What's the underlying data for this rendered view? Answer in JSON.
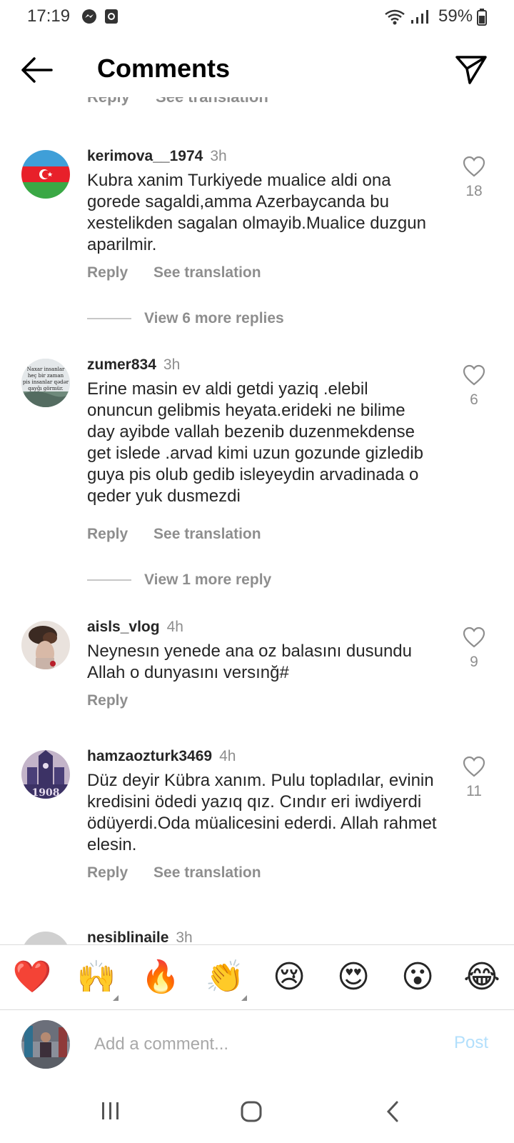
{
  "status_bar": {
    "time": "17:19",
    "battery": "59%"
  },
  "header": {
    "title": "Comments"
  },
  "cut_off_actions": {
    "reply": "Reply",
    "see_translation": "See translation"
  },
  "comments": [
    {
      "username": "kerimova__1974",
      "time": "3h",
      "text": "Kubra xanim Turkiyede mualice aldi ona gorede sagaldi,amma Azerbaycanda  bu xestelikden sagalan olmayib.Mualice duzgun  aparilmir.",
      "likes": "18",
      "reply": "Reply",
      "see_translation": "See translation",
      "view_more": "View 6 more replies"
    },
    {
      "username": "zumer834",
      "time": "3h",
      "text": "Erine masin ev aldi getdi yaziq .elebil onuncun gelibmis heyata.erideki ne bilime day ayibde vallah bezenib duzenmekdense get islede .arvad kimi uzun gozunde gizledib guya pis olub gedib isleyeydin arvadinada o qeder yuk dusmezdi",
      "likes": "6",
      "reply": "Reply",
      "see_translation": "See translation",
      "view_more": "View 1 more reply",
      "avatar_text": [
        "Naxar insanlar",
        "heç bir zaman",
        "pis insanlar qədər",
        "qayğı görmür."
      ]
    },
    {
      "username": "aisls_vlog",
      "time": "4h",
      "text": "Neynesın yenede ana oz balasını dusundu Allah o dunyasını versınğ#",
      "likes": "9",
      "reply": "Reply"
    },
    {
      "username": "hamzaozturk3469",
      "time": "4h",
      "text": "Düz deyir Kübra xanım. Pulu topladılar, evinin kredisini ödedi yazıq qız. Cındır eri iwdiyerdi ödüyerdi.Oda müalicesini ederdi. Allah rahmet elesin.",
      "likes": "11",
      "reply": "Reply",
      "see_translation": "See translation"
    },
    {
      "username": "nesiblinaile",
      "time": "3h"
    }
  ],
  "emoji_bar": [
    "❤️",
    "🙌",
    "🔥",
    "👏",
    "😢",
    "😍",
    "😮",
    "😂"
  ],
  "composer": {
    "placeholder": "Add a comment...",
    "post_label": "Post"
  },
  "colors": {
    "text": "#262626",
    "secondary": "#8e8e8e",
    "post_disabled": "#b2dffc",
    "heart_red": "#ed1c24"
  }
}
